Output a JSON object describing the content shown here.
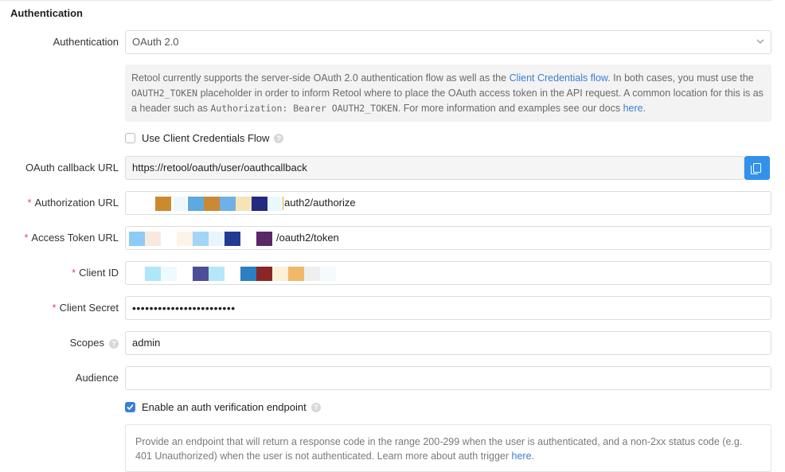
{
  "section": {
    "title": "Authentication"
  },
  "auth": {
    "label": "Authentication",
    "selected": "OAuth 2.0",
    "chevron_icon": "chevron-down-icon"
  },
  "info": {
    "text1": "Retool currently supports the server-side OAuth 2.0 authentication flow as well as the ",
    "link1": "Client Credentials flow",
    "text2": ". In both cases, you must use the ",
    "code1": "OAUTH2_TOKEN",
    "text3": " placeholder in order to inform Retool where to place the OAuth access token in the API request. A common location for this is as a header such as ",
    "code2": "Authorization: Bearer OAUTH2_TOKEN",
    "text4": ". For more information and examples see our docs ",
    "link2": "here",
    "text5": "."
  },
  "client_credentials": {
    "label": "Use Client Credentials Flow",
    "checked": false
  },
  "callback": {
    "label": "OAuth callback URL",
    "value": "https://retool/oauth/user/oauthcallback",
    "copy_icon": "copy-icon"
  },
  "authorization_url": {
    "label": "Authorization URL",
    "value_suffix": "auth2/authorize"
  },
  "access_token_url": {
    "label": "Access Token URL",
    "value_suffix": "/oauth2/token"
  },
  "client_id": {
    "label": "Client ID"
  },
  "client_secret": {
    "label": "Client Secret",
    "value": "••••••••••••••••••••••••"
  },
  "scopes": {
    "label": "Scopes",
    "value": "admin"
  },
  "audience": {
    "label": "Audience",
    "value": ""
  },
  "verify": {
    "label": "Enable an auth verification endpoint",
    "checked": true
  },
  "verify_info": {
    "text1": "Provide an endpoint that will return a response code in the range 200-299 when the user is authenticated, and a non-2xx status code (e.g. 401 Unauthorized) when the user is not authenticated. Learn more about auth trigger ",
    "link": "here",
    "text2": "."
  }
}
